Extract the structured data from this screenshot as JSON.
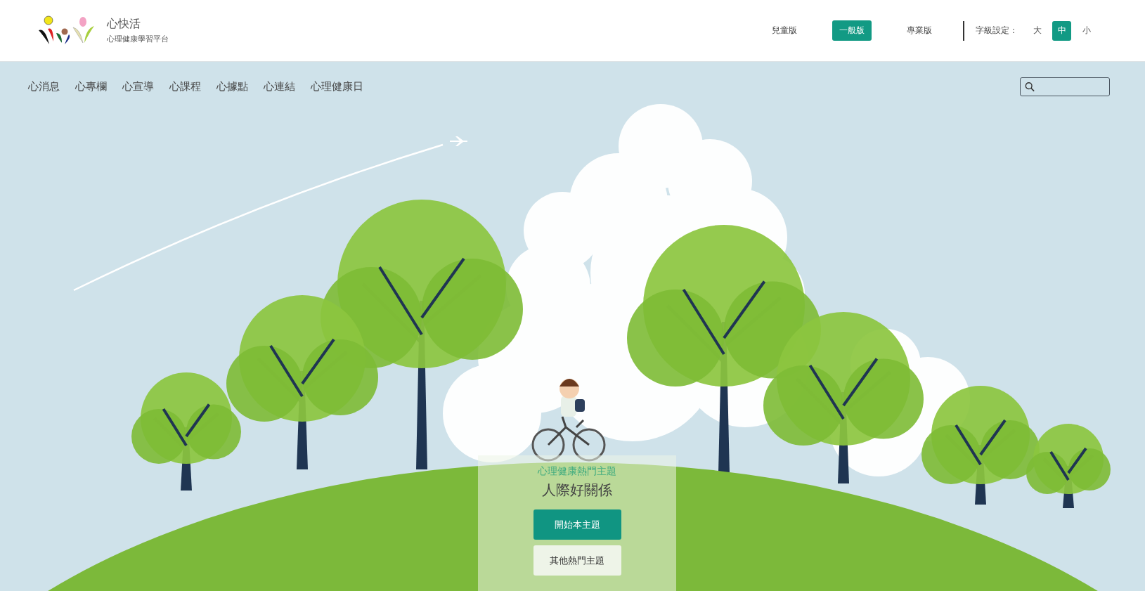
{
  "logo": {
    "title": "心快活",
    "subtitle": "心理健康學習平台"
  },
  "versions": [
    {
      "label": "兒童版",
      "selected": false
    },
    {
      "label": "一般版",
      "selected": true
    },
    {
      "label": "專業版",
      "selected": false
    }
  ],
  "font_size": {
    "label": "字級設定：",
    "options": [
      {
        "label": "大",
        "selected": false
      },
      {
        "label": "中",
        "selected": true
      },
      {
        "label": "小",
        "selected": false
      }
    ]
  },
  "nav": [
    "心消息",
    "心專欄",
    "心宣導",
    "心課程",
    "心據點",
    "心連結",
    "心理健康日"
  ],
  "hero": {
    "kicker": "心理健康熱門主題",
    "title": "人際好關係",
    "buttons": [
      {
        "label": "開始本主題",
        "kind": "primary"
      },
      {
        "label": "其他熱門主題",
        "kind": "secondary"
      }
    ]
  }
}
